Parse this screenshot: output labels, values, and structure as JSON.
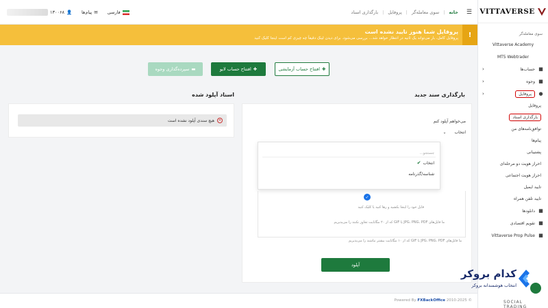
{
  "brand": {
    "name": "VITTAVERSE"
  },
  "topbar": {
    "breadcrumbs": [
      "خانه",
      "سوی معامله‌گر",
      "پروفایل",
      "بارگذاری اسناد"
    ],
    "account_masked": "۱۳۰۰۶۸",
    "messages": "پیام‌ها",
    "language": "فارسی"
  },
  "alert": {
    "title": "پروفایل شما هنوز تایید نشده است",
    "text": "پروفایل کامل، بار می‌تواند یک ثانیه در انتظار خواهد شد... بررسی می‌شود. برای دیدن لینک دقیقاً چه چیزی کم است اینجا کلیک کنید"
  },
  "actions": {
    "demo": "افتتاح حساب آزمایشی",
    "live": "افتتاح حساب لایو",
    "deposit": "سپرده‌گذاری وجوه"
  },
  "upload": {
    "title": "بارگذاری سند جدید",
    "field_label": "می‌خواهم آپلود کنم",
    "select_value": "انتخاب",
    "search_placeholder": "جستجو...",
    "options": [
      "انتخاب",
      "شناسه/گذرنامه"
    ],
    "drop_hint": "فایل خود را اینجا بکشید و رها کنید یا کلیک کنید",
    "format_hint": "ما فایل‌های JPG، PNG، PDF یا GIF که از ۲۰ مگابایت تجاوز نکنند را می‌پذیریم",
    "format_hint2": "ما فایل‌های JPG، PNG، PDF یا GIF که از ۱۰ مگابایت بیشتر نباشند را می‌پذیریم",
    "button": "آپلود"
  },
  "uploaded": {
    "title": "اسناد آپلود شده",
    "empty": "هیچ سندی آپلود نشده است"
  },
  "sidebar": {
    "group_title": "سوی معامله‌گر",
    "items": [
      {
        "label": "Vittaverse Academy",
        "center": true
      },
      {
        "label": "MT5 Webtrader",
        "center": true
      },
      {
        "label": "حساب‌ها",
        "chev": true
      },
      {
        "label": "وجوه",
        "chev": true
      },
      {
        "label": "پروفایل",
        "chev": true,
        "highlight": true
      },
      {
        "label": "پروفایل",
        "sub": true
      },
      {
        "label": "بارگذاری اسناد",
        "sub": true,
        "highlight": true
      },
      {
        "label": "توافق‌نامه‌های من",
        "sub": true
      },
      {
        "label": "پیام‌ها",
        "sub": true
      },
      {
        "label": "پشتیبانی",
        "sub": true
      },
      {
        "label": "احراز هویت دو مرحله‌ای",
        "sub": true
      },
      {
        "label": "احراز هویت اجتماعی",
        "sub": true
      },
      {
        "label": "تایید ایمیل",
        "sub": true
      },
      {
        "label": "تایید تلفن همراه",
        "sub": true
      },
      {
        "label": "دانلودها",
        "icon": true
      },
      {
        "label": "تقویم اقتصادی",
        "icon": true
      },
      {
        "label": "Vittaverse Prop Pulse",
        "icon": true
      }
    ]
  },
  "footer": {
    "prefix": "Powered By",
    "brand": "FXBackOffice",
    "years": "2010-2025 ©"
  },
  "watermark": {
    "title": "کدام بروکر",
    "subtitle": "انتخاب هوشمندانه بروکر",
    "social": "SOCIAL TRADING"
  },
  "colors": {
    "primary": "#1e7a3d",
    "alert": "#f5bf3b",
    "highlight": "#d00000"
  }
}
